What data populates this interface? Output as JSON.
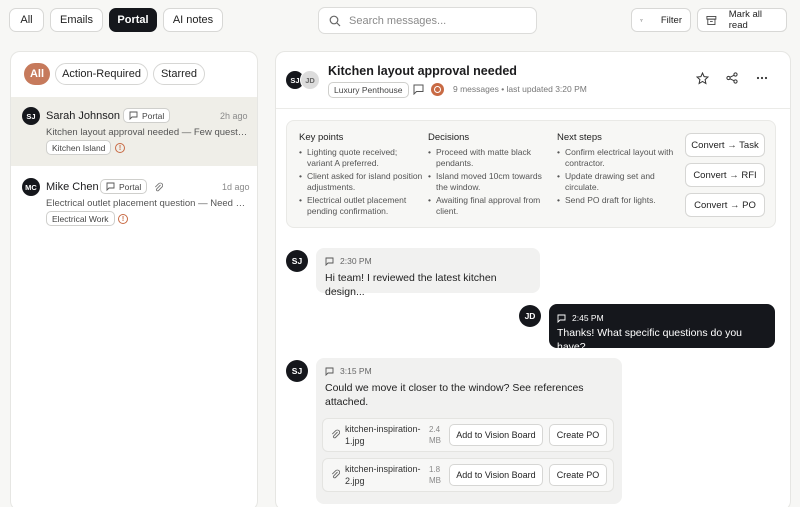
{
  "top_tabs": [
    {
      "label": "All",
      "active": false
    },
    {
      "label": "Emails",
      "active": false
    },
    {
      "label": "Portal",
      "active": true
    },
    {
      "label": "AI notes",
      "active": false
    }
  ],
  "search": {
    "placeholder": "Search messages..."
  },
  "toolbar": {
    "filter_label": "Filter",
    "mark_all_read_label": "Mark all read"
  },
  "left_filters": [
    {
      "label": "All",
      "active": true
    },
    {
      "label": "Action-Required",
      "active": false
    },
    {
      "label": "Starred",
      "active": false
    }
  ],
  "conversations": [
    {
      "initials": "SJ",
      "name": "Sarah Johnson",
      "channel": "Portal",
      "time": "2h ago",
      "preview": "Kitchen layout approval needed — Few questions about the layout",
      "tag": "Kitchen Island",
      "selected": true,
      "has_attachment": false
    },
    {
      "initials": "MC",
      "name": "Mike Chen",
      "channel": "Portal",
      "time": "1d ago",
      "preview": "Electrical outlet placement question — Need clarification",
      "tag": "Electrical Work",
      "selected": false,
      "has_attachment": true
    }
  ],
  "thread": {
    "avatar_1": "SJ",
    "avatar_2": "JD",
    "title": "Kitchen layout approval needed",
    "project_tag": "Luxury Penthouse",
    "meta": "9 messages • last updated 3:20 PM"
  },
  "summary": {
    "key_points": {
      "heading": "Key points",
      "items": [
        "Lighting quote received; variant A preferred.",
        "Client asked for island position adjustments.",
        "Electrical outlet placement pending confirmation."
      ]
    },
    "decisions": {
      "heading": "Decisions",
      "items": [
        "Proceed with matte black pendants.",
        "Island moved 10cm towards the window.",
        "Awaiting final approval from client."
      ]
    },
    "next_steps": {
      "heading": "Next steps",
      "items": [
        "Confirm electrical layout with contractor.",
        "Update drawing set and circulate.",
        "Send PO draft for lights."
      ]
    },
    "actions": [
      "Convert → Task",
      "Convert → RFI",
      "Convert → PO"
    ]
  },
  "messages": [
    {
      "initials": "SJ",
      "time": "2:30 PM",
      "text": "Hi team! I reviewed the latest kitchen design..."
    },
    {
      "initials": "JD",
      "time": "2:45 PM",
      "text": "Thanks! What specific questions do you have?"
    },
    {
      "initials": "SJ",
      "time": "3:15 PM",
      "text": "Could we move it closer to the window? See references attached.",
      "attachments": [
        {
          "name": "kitchen-inspiration-1.jpg",
          "size": "2.4 MB",
          "action_1": "Add to Vision Board",
          "action_2": "Create PO"
        },
        {
          "name": "kitchen-inspiration-2.jpg",
          "size": "1.8 MB",
          "action_1": "Add to Vision Board",
          "action_2": "Create PO"
        }
      ]
    }
  ],
  "colors": {
    "accent": "#c67a5c",
    "dark": "#15171c",
    "selected_row": "#efeee8",
    "warning": "#c86a44"
  }
}
